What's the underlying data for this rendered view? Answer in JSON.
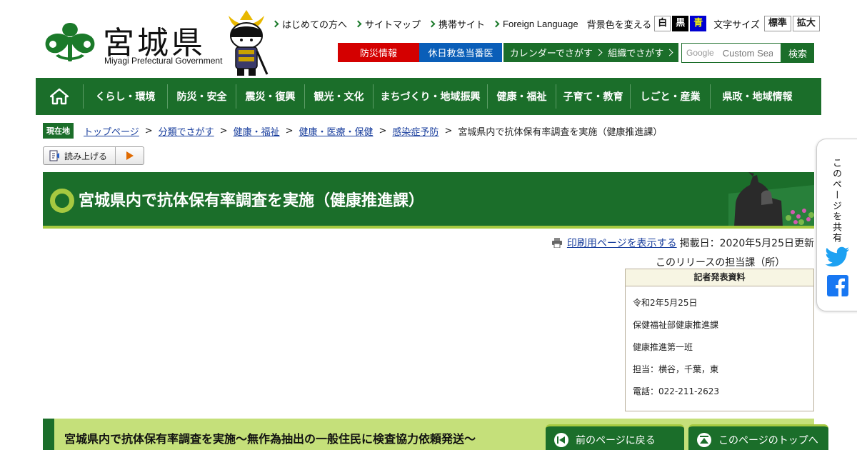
{
  "logo": {
    "title": "宮城県",
    "subtitle": "Miyagi Prefectural Government"
  },
  "toplinks": {
    "beginners": "はじめての方へ",
    "sitemap": "サイトマップ",
    "mobile": "携帯サイト",
    "foreign": "Foreign Language",
    "bg_label": "背景色を変える",
    "bg_white": "白",
    "bg_black": "黒",
    "bg_blue": "青",
    "fontsize_label": "文字サイズ",
    "fs_normal": "標準",
    "fs_large": "拡大"
  },
  "actions": {
    "disaster": "防災情報",
    "holiday_doctor": "休日救急当番医",
    "calendar": "カレンダーでさがす",
    "org": "組織でさがす"
  },
  "search": {
    "placeholder": "Custom Search",
    "google": "Google",
    "button": "検索"
  },
  "nav": {
    "items": [
      "くらし・環境",
      "防災・安全",
      "震災・復興",
      "観光・文化",
      "まちづくり・地域振興",
      "健康・福祉",
      "子育て・教育",
      "しごと・産業",
      "県政・地域情報"
    ]
  },
  "breadcrumb": {
    "badge": "現在地",
    "links": [
      "トップページ",
      "分類でさがす",
      "健康・福祉",
      "健康・医療・保健",
      "感染症予防"
    ],
    "current": "宮城県内で抗体保有率調査を実施（健康推進課）",
    "sep": ">"
  },
  "readaloud": {
    "label": "読み上げる"
  },
  "page": {
    "title": "宮城県内で抗体保有率調査を実施（健康推進課）"
  },
  "meta": {
    "print_link": "印刷用ページを表示する",
    "posted": "掲載日：2020年5月25日更新",
    "owner_heading": "このリリースの担当課（所）"
  },
  "press": {
    "heading": "記者発表資料",
    "date": "令和2年5月25日",
    "dept": "保健福祉部健康推進課",
    "team": "健康推進第一班",
    "contacts": "担当：横谷，千葉，東",
    "phone": "電話：022-211-2623"
  },
  "share": {
    "label": "このページを共有"
  },
  "subhead": {
    "text": "宮城県内で抗体保有率調査を実施～無作為抽出の一般住民に検査協力依頼発送～"
  },
  "floating": {
    "prev": "前のページに戻る",
    "top": "このページのトップへ"
  },
  "colors": {
    "brand_green": "#1b6e2a",
    "accent_lime": "#a6c940",
    "disaster_red": "#d40000",
    "holiday_blue": "#0a5eb8"
  }
}
